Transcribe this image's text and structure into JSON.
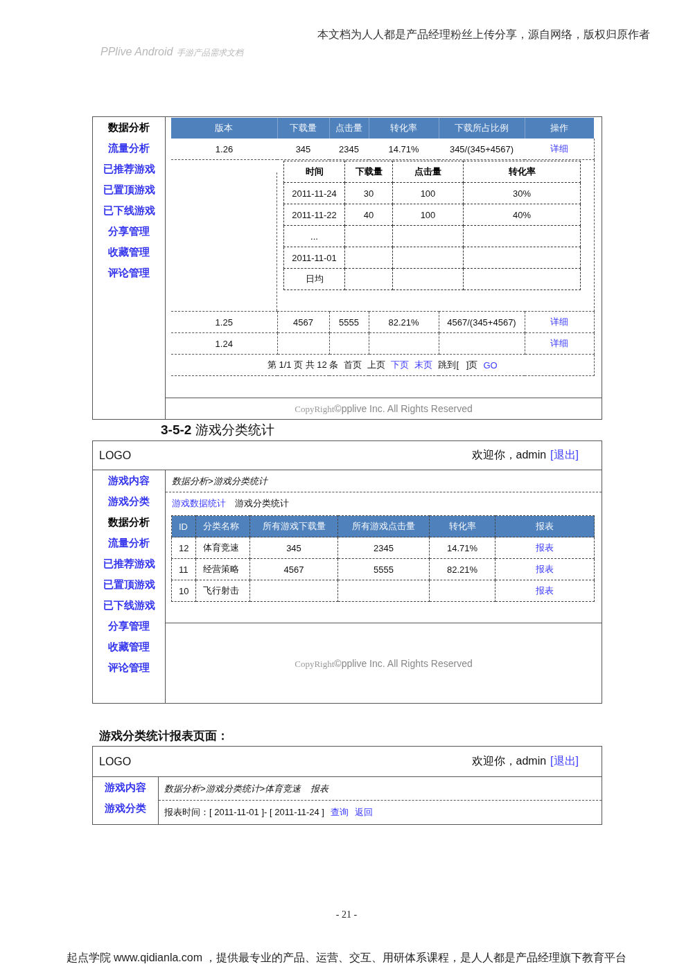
{
  "page_header": {
    "notice": "本文档为人人都是产品经理粉丝上传分享，源自网络，版权归原作者",
    "doc_title": "PPlive Android",
    "doc_subtitle": "手游产品需求文档"
  },
  "traffic_page": {
    "sidebar": {
      "items": [
        {
          "label": "数据分析",
          "kind": "heading"
        },
        {
          "label": "流量分析",
          "kind": "link"
        },
        {
          "label": "已推荐游戏",
          "kind": "link"
        },
        {
          "label": "已置顶游戏",
          "kind": "link"
        },
        {
          "label": "已下线游戏",
          "kind": "link"
        },
        {
          "label": "分享管理",
          "kind": "link"
        },
        {
          "label": "收藏管理",
          "kind": "link"
        },
        {
          "label": "评论管理",
          "kind": "link"
        }
      ]
    },
    "table": {
      "columns": [
        "版本",
        "下载量",
        "点击量",
        "转化率",
        "下载所占比例",
        "操作"
      ],
      "rows": [
        {
          "cells": [
            "1.26",
            "345",
            "2345",
            "14.71%",
            "345/(345+4567)"
          ],
          "action": "详细",
          "expanded": true,
          "detail": {
            "columns": [
              "时间",
              "下载量",
              "点击量",
              "转化率"
            ],
            "rows": [
              [
                "2011-11-24",
                "30",
                "100",
                "30%"
              ],
              [
                "2011-11-22",
                "40",
                "100",
                "40%"
              ],
              [
                "..."
              ],
              [
                "2011-11-01"
              ],
              [
                "日均"
              ]
            ]
          }
        },
        {
          "cells": [
            "1.25",
            "4567",
            "5555",
            "82.21%",
            "4567/(345+4567)"
          ],
          "action": "详细",
          "expanded": false
        },
        {
          "cells": [
            "1.24"
          ],
          "action": "详细",
          "expanded": false
        }
      ]
    },
    "pagination": {
      "info": "第 1/1 页 共 12 条",
      "links": [
        {
          "label": "首页",
          "disabled": true
        },
        {
          "label": "上页",
          "disabled": true
        },
        {
          "label": "下页",
          "disabled": false
        },
        {
          "label": "末页",
          "disabled": false
        }
      ],
      "jump": "跳到[   ]页",
      "go": "GO"
    },
    "footer": {
      "mark": "CopyRight",
      "text": "©pplive Inc. All Rights Reserved"
    }
  },
  "section_heading": {
    "number": "3-5-2",
    "title": "游戏分类统计"
  },
  "category_page": {
    "top_bar": {
      "logo": "LOGO",
      "greeting": "欢迎你，admin",
      "logout": "[退出]"
    },
    "sidebar": {
      "items": [
        {
          "label": "游戏内容",
          "kind": "link"
        },
        {
          "label": "游戏分类",
          "kind": "link"
        },
        {
          "label": "数据分析",
          "kind": "heading"
        },
        {
          "label": "流量分析",
          "kind": "link"
        },
        {
          "label": "已推荐游戏",
          "kind": "link"
        },
        {
          "label": "已置顶游戏",
          "kind": "link"
        },
        {
          "label": "已下线游戏",
          "kind": "link"
        },
        {
          "label": "分享管理",
          "kind": "link"
        },
        {
          "label": "收藏管理",
          "kind": "link"
        },
        {
          "label": "评论管理",
          "kind": "link"
        }
      ]
    },
    "breadcrumb": "数据分析>游戏分类统计",
    "tabs": [
      {
        "label": "游戏数据统计",
        "selected": false
      },
      {
        "label": "游戏分类统计",
        "selected": true
      }
    ],
    "table": {
      "columns": [
        "ID",
        "分类名称",
        "所有游戏下载量",
        "所有游戏点击量",
        "转化率",
        "报表"
      ],
      "rows": [
        {
          "cells": [
            "12",
            "体育竞速",
            "345",
            "2345",
            "14.71%"
          ],
          "action": "报表"
        },
        {
          "cells": [
            "11",
            "经营策略",
            "4567",
            "5555",
            "82.21%"
          ],
          "action": "报表"
        },
        {
          "cells": [
            "10",
            "飞行射击"
          ],
          "action": "报表"
        }
      ]
    },
    "footer": {
      "mark": "CopyRight",
      "text": "©pplive Inc. All Rights Reserved"
    }
  },
  "report_heading": "游戏分类统计报表页面：",
  "report_page": {
    "top_bar": {
      "logo": "LOGO",
      "greeting": "欢迎你，admin",
      "logout": "[退出]"
    },
    "sidebar": {
      "items": [
        {
          "label": "游戏内容",
          "kind": "link"
        },
        {
          "label": "游戏分类",
          "kind": "link"
        }
      ]
    },
    "breadcrumb": "数据分析>游戏分类统计>体育竞速",
    "page_label": "报表",
    "filter": {
      "text": "报表时间：[ 2011-11-01 ]- [ 2011-11-24 ]",
      "actions": [
        "查询",
        "返回"
      ]
    }
  },
  "page_number": "- 21 -",
  "page_footer": "起点学院 www.qidianla.com ，提供最专业的产品、运营、交互、用研体系课程，是人人都是产品经理旗下教育平台"
}
